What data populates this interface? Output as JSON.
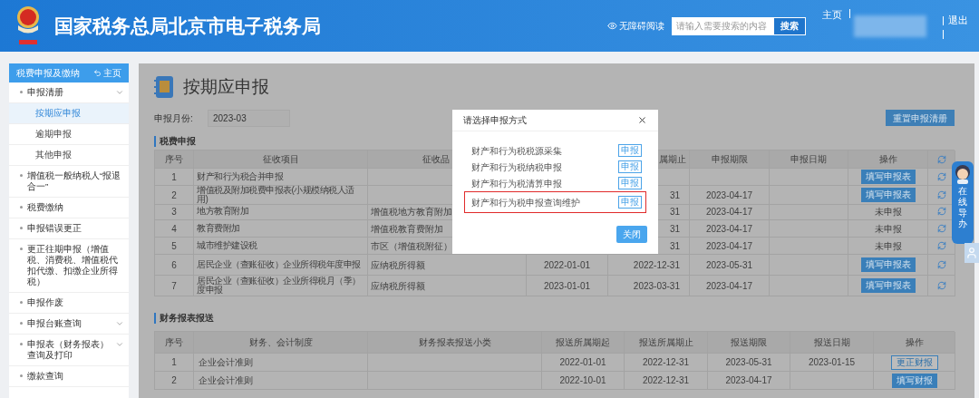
{
  "header": {
    "title": "国家税务总局北京市电子税务局",
    "accessibility": "无障碍阅读",
    "search": {
      "placeholder": "请输入需要搜索的内容",
      "button": "搜索"
    },
    "home": "主页",
    "logout": "退出"
  },
  "sidebar": {
    "title": "税费申报及缴纳",
    "home": "主页",
    "items": [
      {
        "label": "申报清册",
        "selected": false,
        "submenu": true,
        "children": [
          {
            "label": "按期应申报",
            "selected": true
          },
          {
            "label": "逾期申报",
            "selected": false
          },
          {
            "label": "其他申报",
            "selected": false
          }
        ]
      },
      {
        "label": "增值税一般纳税人“报退合一”",
        "selected": false,
        "submenu": false
      },
      {
        "label": "税费缴纳",
        "selected": false,
        "submenu": false
      },
      {
        "label": "申报错误更正",
        "selected": false,
        "submenu": false
      },
      {
        "label": "更正往期申报（增值税、消费税、增值税代扣代缴、扣缴企业所得税）",
        "selected": false,
        "submenu": false
      },
      {
        "label": "申报作废",
        "selected": false,
        "submenu": false
      },
      {
        "label": "申报台账查询",
        "selected": false,
        "submenu": true
      },
      {
        "label": "申报表（财务报表）查询及打印",
        "selected": false,
        "submenu": true
      },
      {
        "label": "缴款查询",
        "selected": false,
        "submenu": false
      }
    ]
  },
  "main": {
    "title": "按期应申报",
    "month_label": "申报月份:",
    "month_value": "2023-03",
    "reset_button": "重置申报清册",
    "tax_table": {
      "heading": "税费申报",
      "columns": {
        "no": "序号",
        "item": "征收项目",
        "category": "征收品",
        "period_end": "属期止",
        "deadline": "申报期限",
        "date": "申报日期",
        "action": "操作"
      },
      "rows": [
        {
          "no": "1",
          "item": "财产和行为税合并申报",
          "action": {
            "kind": "button",
            "label": "填写申报表"
          }
        },
        {
          "no": "2",
          "item": "增值税及附加税费申报表(小规模纳税人适用)",
          "period_end": "31",
          "deadline": "2023-04-17",
          "action": {
            "kind": "button",
            "label": "填写申报表"
          }
        },
        {
          "no": "3",
          "item": "地方教育附加",
          "category": "增值税地方教育附加",
          "period_end": "31",
          "deadline": "2023-04-17",
          "action": {
            "kind": "text",
            "label": "未申报"
          }
        },
        {
          "no": "4",
          "item": "教育费附加",
          "category": "增值税教育费附加",
          "period_end": "31",
          "deadline": "2023-04-17",
          "action": {
            "kind": "text",
            "label": "未申报"
          }
        },
        {
          "no": "5",
          "item": "城市维护建设税",
          "category": "市区（增值税附征）",
          "period_end": "31",
          "deadline": "2023-04-17",
          "action": {
            "kind": "text",
            "label": "未申报"
          }
        },
        {
          "no": "6",
          "item": "居民企业（查账征收）企业所得税年度申报",
          "category": "应纳税所得额",
          "period_start": "2022-01-01",
          "period_end": "2022-12-31",
          "deadline": "2023-05-31",
          "action": {
            "kind": "button",
            "label": "填写申报表"
          }
        },
        {
          "no": "7",
          "item": "居民企业（查账征收）企业所得税月（季）度申报",
          "category": "应纳税所得额",
          "period_start": "2023-01-01",
          "period_end": "2023-03-31",
          "deadline": "2023-04-17",
          "action": {
            "kind": "button",
            "label": "填写申报表"
          }
        }
      ]
    },
    "finance_table": {
      "heading": "财务报表报送",
      "columns": [
        "序号",
        "财务、会计制度",
        "财务报表报送小类",
        "报送所属期起",
        "报送所属期止",
        "报送期限",
        "报送日期",
        "操作"
      ],
      "rows": [
        {
          "no": "1",
          "system": "企业会计准则",
          "period_start": "2022-01-01",
          "period_end": "2022-12-31",
          "deadline": "2023-05-31",
          "date": "2023-01-15",
          "action": {
            "kind": "outline",
            "label": "更正财报"
          }
        },
        {
          "no": "2",
          "system": "企业会计准则",
          "period_start": "2022-10-01",
          "period_end": "2022-12-31",
          "deadline": "2023-04-17",
          "action": {
            "kind": "filled",
            "label": "填写财报"
          }
        }
      ]
    }
  },
  "dialog": {
    "title": "请选择申报方式",
    "options": [
      {
        "label": "财产和行为税税源采集",
        "button": "申报",
        "highlighted": false
      },
      {
        "label": "财产和行为税纳税申报",
        "button": "申报",
        "highlighted": false
      },
      {
        "label": "财产和行为税清算申报",
        "button": "申报",
        "highlighted": false
      },
      {
        "label": "财产和行为税申报查询维护",
        "button": "申报",
        "highlighted": true
      }
    ],
    "close_button": "关闭"
  },
  "assistant": {
    "label": "在线导办"
  }
}
